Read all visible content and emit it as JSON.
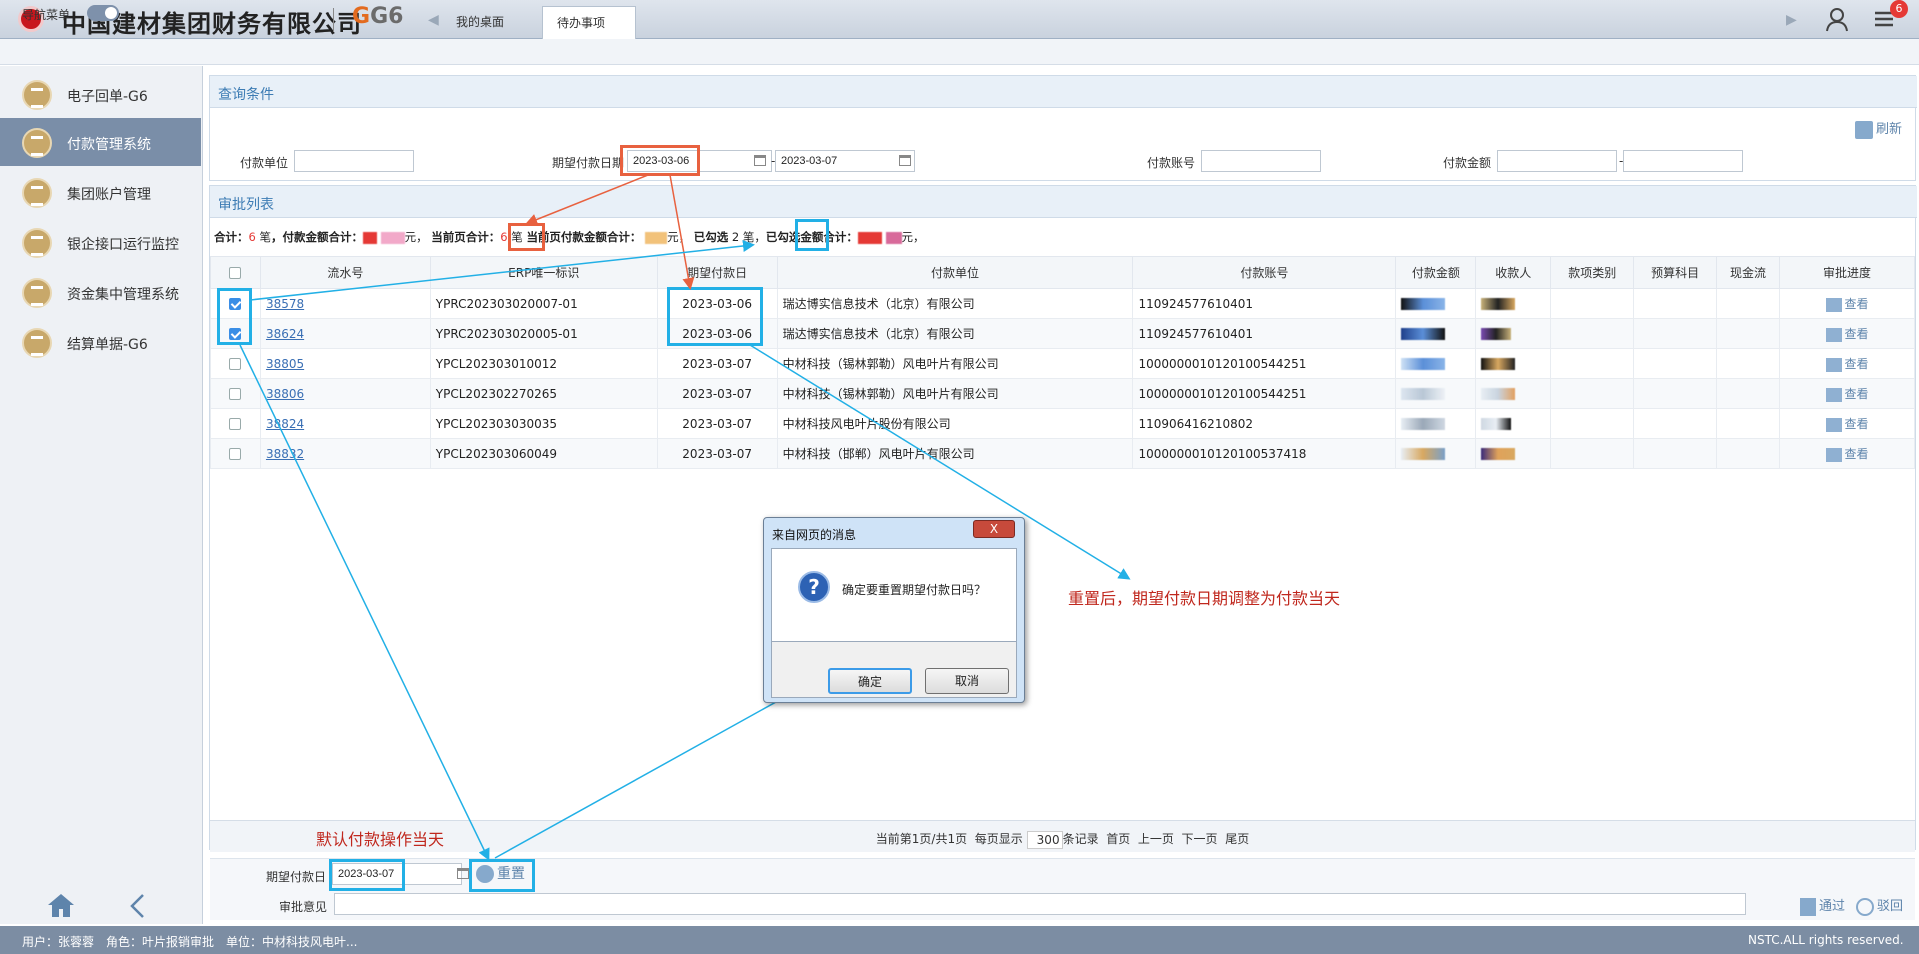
{
  "header": {
    "company": "中国建材集团财务有限公司",
    "product": "G6",
    "tabs": [
      {
        "label": "我的桌面"
      },
      {
        "label": "待办事项",
        "close": "×"
      }
    ],
    "badge_count": "6"
  },
  "navbar": {
    "label": "导航菜单"
  },
  "sidebar": {
    "items": [
      {
        "label": "电子回单-G6"
      },
      {
        "label": "付款管理系统"
      },
      {
        "label": "集团账户管理"
      },
      {
        "label": "银企接口运行监控"
      },
      {
        "label": "资金集中管理系统"
      },
      {
        "label": "结算单据-G6"
      }
    ]
  },
  "query": {
    "title": "查询条件",
    "refresh": "刷新",
    "payer_label": "付款单位",
    "date_label": "期望付款日期",
    "date_from": "2023-03-06",
    "date_sep": "-",
    "date_to": "2023-03-07",
    "account_label": "付款账号",
    "amount_label": "付款金额",
    "amount_sep": "-"
  },
  "approval": {
    "title": "审批列表",
    "summary": {
      "total_label": "合计：",
      "total_count": "6",
      "unit": "笔",
      "amount_total_label": "，付款金额合计：",
      "yuan": "元，",
      "page_total_label": "当前页合计：",
      "page_count": "6",
      "page_amount_label": "当前页付款金额合计：",
      "selected_label": "已勾选",
      "selected_count": "2",
      "selected_amount_label": "已勾选金额合计：",
      "end": "元，"
    },
    "columns": [
      "流水号",
      "ERP唯一标识",
      "期望付款日",
      "付款单位",
      "付款账号",
      "付款金额",
      "收款人",
      "款项类别",
      "预算科目",
      "现金流",
      "审批进度"
    ],
    "rows": [
      {
        "checked": true,
        "serial": "38578",
        "erp": "YPRC202303020007-01",
        "date": "2023-03-06",
        "payer": "瑞达博实信息技术（北京）有限公司",
        "account": "110924577610401",
        "view": "查看"
      },
      {
        "checked": true,
        "serial": "38624",
        "erp": "YPRC202303020005-01",
        "date": "2023-03-06",
        "payer": "瑞达博实信息技术（北京）有限公司",
        "account": "110924577610401",
        "view": "查看"
      },
      {
        "checked": false,
        "serial": "38805",
        "erp": "YPCL202303010012",
        "date": "2023-03-07",
        "payer": "中材科技（锡林郭勒）风电叶片有限公司",
        "account": "100000001012010054425​1",
        "view": "查看"
      },
      {
        "checked": false,
        "serial": "38806",
        "erp": "YPCL202302270265",
        "date": "2023-03-07",
        "payer": "中材科技（锡林郭勒）风电叶片有限公司",
        "account": "1000000010120100544251",
        "view": "查看"
      },
      {
        "checked": false,
        "serial": "38824",
        "erp": "YPCL202303030035",
        "date": "2023-03-07",
        "payer": "中材科技风电叶片股份有限公司",
        "account": "110906416210802",
        "view": "查看"
      },
      {
        "checked": false,
        "serial": "38832",
        "erp": "YPCL202303060049",
        "date": "2023-03-07",
        "payer": "中材科技（邯郸）风电叶片有限公司",
        "account": "1000000010120100537418",
        "view": "查看"
      }
    ]
  },
  "pager": {
    "info": "当前第1页/共1页",
    "per_page_label": "每页显示",
    "per_page": "300",
    "records": "条记录",
    "first": "首页",
    "prev": "上一页",
    "next": "下一页",
    "last": "尾页"
  },
  "bottom": {
    "date_label": "期望付款日",
    "date_value": "2023-03-07",
    "reset": "重置",
    "opinion_label": "审批意见",
    "approve": "通过",
    "reject": "驳回"
  },
  "dialog": {
    "title": "来自网页的消息",
    "close": "X",
    "message": "确定要重置期望付款日吗？",
    "ok": "确定",
    "cancel": "取消"
  },
  "annotations": {
    "note1": "重置后，期望付款日期调整为付款当天",
    "note2": "默认付款操作当天"
  },
  "footer": {
    "user": "用户：张蓉蓉　角色：叶片报销审批　单位：中材科技风电叶...",
    "copyright": "NSTC.ALL rights reserved."
  },
  "colors": {
    "accent": "#3d7cb4",
    "annotation_red": "#e8613f",
    "annotation_blue": "#22b0e6",
    "sidebar_active": "#7a8ea8"
  }
}
